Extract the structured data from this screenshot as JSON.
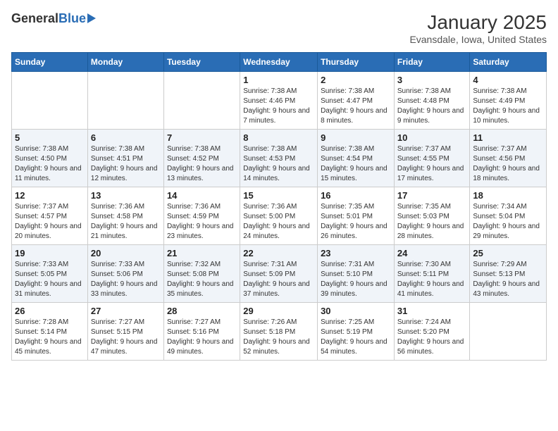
{
  "header": {
    "logo_general": "General",
    "logo_blue": "Blue",
    "title": "January 2025",
    "subtitle": "Evansdale, Iowa, United States"
  },
  "weekdays": [
    "Sunday",
    "Monday",
    "Tuesday",
    "Wednesday",
    "Thursday",
    "Friday",
    "Saturday"
  ],
  "weeks": [
    [
      {
        "day": "",
        "info": ""
      },
      {
        "day": "",
        "info": ""
      },
      {
        "day": "",
        "info": ""
      },
      {
        "day": "1",
        "info": "Sunrise: 7:38 AM\nSunset: 4:46 PM\nDaylight: 9 hours and 7 minutes."
      },
      {
        "day": "2",
        "info": "Sunrise: 7:38 AM\nSunset: 4:47 PM\nDaylight: 9 hours and 8 minutes."
      },
      {
        "day": "3",
        "info": "Sunrise: 7:38 AM\nSunset: 4:48 PM\nDaylight: 9 hours and 9 minutes."
      },
      {
        "day": "4",
        "info": "Sunrise: 7:38 AM\nSunset: 4:49 PM\nDaylight: 9 hours and 10 minutes."
      }
    ],
    [
      {
        "day": "5",
        "info": "Sunrise: 7:38 AM\nSunset: 4:50 PM\nDaylight: 9 hours and 11 minutes."
      },
      {
        "day": "6",
        "info": "Sunrise: 7:38 AM\nSunset: 4:51 PM\nDaylight: 9 hours and 12 minutes."
      },
      {
        "day": "7",
        "info": "Sunrise: 7:38 AM\nSunset: 4:52 PM\nDaylight: 9 hours and 13 minutes."
      },
      {
        "day": "8",
        "info": "Sunrise: 7:38 AM\nSunset: 4:53 PM\nDaylight: 9 hours and 14 minutes."
      },
      {
        "day": "9",
        "info": "Sunrise: 7:38 AM\nSunset: 4:54 PM\nDaylight: 9 hours and 15 minutes."
      },
      {
        "day": "10",
        "info": "Sunrise: 7:37 AM\nSunset: 4:55 PM\nDaylight: 9 hours and 17 minutes."
      },
      {
        "day": "11",
        "info": "Sunrise: 7:37 AM\nSunset: 4:56 PM\nDaylight: 9 hours and 18 minutes."
      }
    ],
    [
      {
        "day": "12",
        "info": "Sunrise: 7:37 AM\nSunset: 4:57 PM\nDaylight: 9 hours and 20 minutes."
      },
      {
        "day": "13",
        "info": "Sunrise: 7:36 AM\nSunset: 4:58 PM\nDaylight: 9 hours and 21 minutes."
      },
      {
        "day": "14",
        "info": "Sunrise: 7:36 AM\nSunset: 4:59 PM\nDaylight: 9 hours and 23 minutes."
      },
      {
        "day": "15",
        "info": "Sunrise: 7:36 AM\nSunset: 5:00 PM\nDaylight: 9 hours and 24 minutes."
      },
      {
        "day": "16",
        "info": "Sunrise: 7:35 AM\nSunset: 5:01 PM\nDaylight: 9 hours and 26 minutes."
      },
      {
        "day": "17",
        "info": "Sunrise: 7:35 AM\nSunset: 5:03 PM\nDaylight: 9 hours and 28 minutes."
      },
      {
        "day": "18",
        "info": "Sunrise: 7:34 AM\nSunset: 5:04 PM\nDaylight: 9 hours and 29 minutes."
      }
    ],
    [
      {
        "day": "19",
        "info": "Sunrise: 7:33 AM\nSunset: 5:05 PM\nDaylight: 9 hours and 31 minutes."
      },
      {
        "day": "20",
        "info": "Sunrise: 7:33 AM\nSunset: 5:06 PM\nDaylight: 9 hours and 33 minutes."
      },
      {
        "day": "21",
        "info": "Sunrise: 7:32 AM\nSunset: 5:08 PM\nDaylight: 9 hours and 35 minutes."
      },
      {
        "day": "22",
        "info": "Sunrise: 7:31 AM\nSunset: 5:09 PM\nDaylight: 9 hours and 37 minutes."
      },
      {
        "day": "23",
        "info": "Sunrise: 7:31 AM\nSunset: 5:10 PM\nDaylight: 9 hours and 39 minutes."
      },
      {
        "day": "24",
        "info": "Sunrise: 7:30 AM\nSunset: 5:11 PM\nDaylight: 9 hours and 41 minutes."
      },
      {
        "day": "25",
        "info": "Sunrise: 7:29 AM\nSunset: 5:13 PM\nDaylight: 9 hours and 43 minutes."
      }
    ],
    [
      {
        "day": "26",
        "info": "Sunrise: 7:28 AM\nSunset: 5:14 PM\nDaylight: 9 hours and 45 minutes."
      },
      {
        "day": "27",
        "info": "Sunrise: 7:27 AM\nSunset: 5:15 PM\nDaylight: 9 hours and 47 minutes."
      },
      {
        "day": "28",
        "info": "Sunrise: 7:27 AM\nSunset: 5:16 PM\nDaylight: 9 hours and 49 minutes."
      },
      {
        "day": "29",
        "info": "Sunrise: 7:26 AM\nSunset: 5:18 PM\nDaylight: 9 hours and 52 minutes."
      },
      {
        "day": "30",
        "info": "Sunrise: 7:25 AM\nSunset: 5:19 PM\nDaylight: 9 hours and 54 minutes."
      },
      {
        "day": "31",
        "info": "Sunrise: 7:24 AM\nSunset: 5:20 PM\nDaylight: 9 hours and 56 minutes."
      },
      {
        "day": "",
        "info": ""
      }
    ]
  ]
}
